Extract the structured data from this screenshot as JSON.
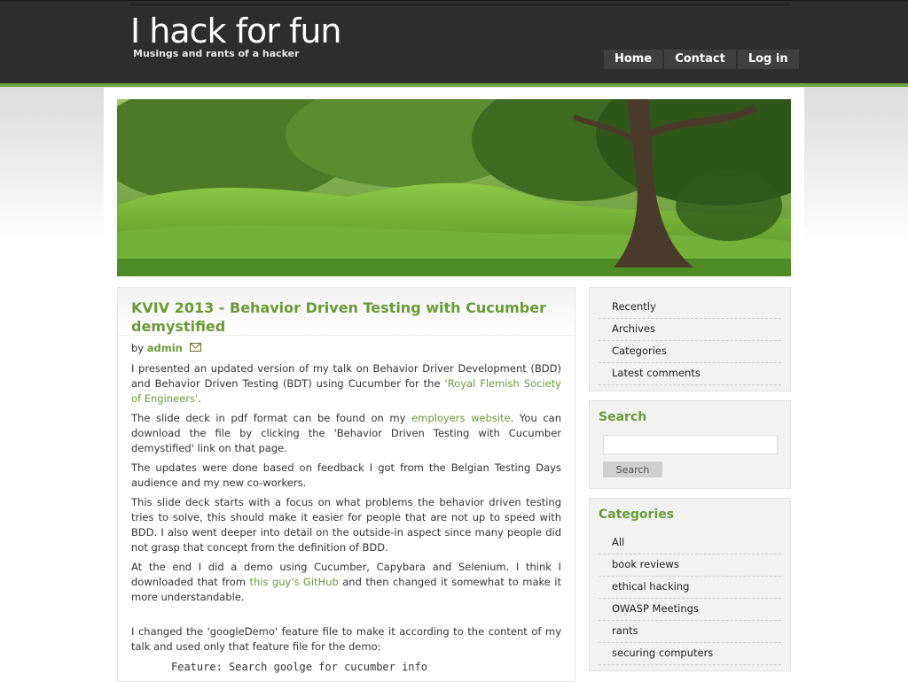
{
  "site": {
    "title": "I hack for fun",
    "subtitle": "Musings and rants of a hacker"
  },
  "nav": [
    "Home",
    "Contact",
    "Log in"
  ],
  "post": {
    "title": "KVIV 2013 - Behavior Driven Testing with Cucumber demystified",
    "by_prefix": "by",
    "author": "admin",
    "p1_a": "I presented an updated version of my talk on Behavior Driver Development (BDD) and Behavior Driven Testing (BDT) using Cucumber for the ",
    "p1_link": "'Royal Flemish Society of Engineers'",
    "p1_b": ".",
    "p2_a": "The slide deck in pdf format can be found on my ",
    "p2_link": "employers website",
    "p2_b": ". You can download the file by clicking the 'Behavior Driven Testing with Cucumber demystified' link on that page.",
    "p3": "The updates were done based on feedback I got from the Belgian Testing Days audience and my new co-workers.",
    "p4": "This slide deck starts with a focus on what problems the behavior driven testing tries to solve, this should make it easier for people that are not up to speed with BDD. I also went deeper into detail on the outside-in aspect since many people did not grasp that concept from the definition of BDD.",
    "p5_a": "At the end I did a demo using Cucumber, Capybara and Selenium. I think I downloaded that  from ",
    "p5_link": "this guy's GitHub",
    "p5_b": " and then changed it somewhat to make it more understandable.",
    "p6": "I changed the 'googleDemo' feature file to make it according to the content of my talk and used only that feature file for the demo:",
    "code": "Feature: Search goolge for cucumber info"
  },
  "sidebar": {
    "menu": [
      "Recently",
      "Archives",
      "Categories",
      "Latest comments"
    ],
    "search_title": "Search",
    "search_button": "Search",
    "categories_title": "Categories",
    "categories": [
      "All",
      "book reviews",
      "ethical hacking",
      "OWASP Meetings",
      "rants",
      "securing computers"
    ]
  },
  "colors": {
    "accent": "#6a9a37",
    "header_bg": "#2d2d2d",
    "bar": "#6aa336"
  }
}
